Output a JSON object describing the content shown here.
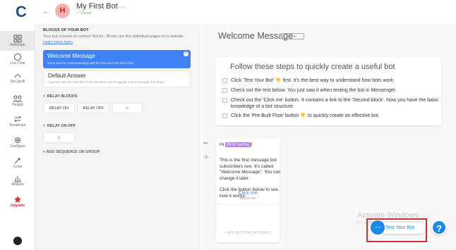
{
  "app": {
    "logo_letter": "C"
  },
  "header": {
    "back_glyph": "←",
    "avatar_letter": "H",
    "bot_name": "My First Bot",
    "saved": "✓ Saved",
    "crumb": "chatfuel..."
  },
  "sidebar": {
    "items": [
      {
        "label": "Automate",
        "icon": "automate-icon"
      },
      {
        "label": "Live Chat",
        "icon": "live-chat-icon"
      },
      {
        "label": "Set Up AI",
        "icon": "ai-icon"
      },
      {
        "label": "People",
        "icon": "people-icon"
      },
      {
        "label": "Broadcast",
        "icon": "broadcast-icon"
      },
      {
        "label": "Configure",
        "icon": "gear-icon"
      },
      {
        "label": "Grow",
        "icon": "grow-icon"
      },
      {
        "label": "Analyze",
        "icon": "analyze-icon"
      },
      {
        "label": "Upgrade",
        "icon": "star-icon"
      }
    ]
  },
  "blocks": {
    "title": "BLOCKS OF YOUR BOT",
    "desc": "Your bot consists of content 'blocks'. Blocks are like individual pages on a website.",
    "learn_more": "Learn more here.",
    "welcome": {
      "title": "Welcome Message",
      "sub": "Every person communicating with the bot sees this block first."
    },
    "default": {
      "title": "Default Answer",
      "sub": "A person will see this block if the bot does not recognize a text message from them."
    },
    "relay_blocks": "RELAY BLOCKS",
    "relay_on": "RELAY ON",
    "relay_off": "RELAY OFF",
    "relay_on_off": "RELAY ON OFF",
    "plus": "+",
    "add_seq": "+ ADD SEQUENCE OR GROUP"
  },
  "main": {
    "title": "Welcome Message",
    "link_label": "LINK",
    "steps_title": "Follow these steps to quickly create a useful bot",
    "steps": [
      "Click 'Test Your Bot' 👇 first. It's the best way to understand how bots work.",
      "Check out the text below. You just saw it when testing the bot in Messenger.",
      "Check out the 'Click me' button. It contains a link to the 'Second block'. Now you have the basic knowledge of a bot structure.",
      "Click the 'Pre-Built Flow' button 👇 to quickly create an effective bot."
    ],
    "msg_hi": "Hi",
    "msg_name": "{first name}",
    "msg_bang": "!",
    "msg_body1": "This is the first message bot subscribers see. It's called \"Welcome Message\". You can change it later.",
    "msg_body2": "Click the button below to see how it works.",
    "click_me": "Click me",
    "click_me_target": "RELAY ON",
    "add_button": "+ ADD BUTTON (OPTIONAL)",
    "dots": "•••",
    "move": "✣"
  },
  "watermark": {
    "line1": "Activate Windows",
    "line2": "Go to Settings to activate Windows."
  },
  "test_bot": {
    "label": "Test Your Bot"
  },
  "help": {
    "label": "?"
  }
}
